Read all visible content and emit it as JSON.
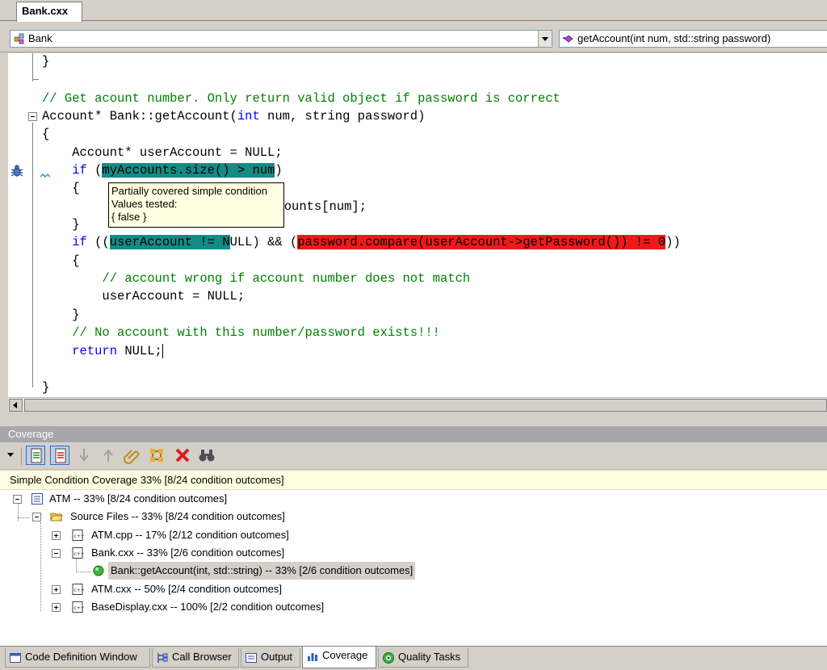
{
  "document": {
    "tab_label": "Bank.cxx"
  },
  "navigation": {
    "class_combo": "Bank",
    "member_combo": "getAccount(int num, std::string password)"
  },
  "code": {
    "l0": "}",
    "comment1": "// Get acount number. Only return valid object if password is correct",
    "sig_a": "Account* Bank::getAccount(",
    "sig_int": "int",
    "sig_b": " num, string password)",
    "l_open": "{",
    "decl": "    Account* userAccount = NULL;",
    "if_kw": "if",
    "if1_open": " (",
    "if1_cond": "myAccounts.size() > num",
    "if1_close": ")",
    "l_open2": "    {",
    "assign_tail": "nt*)myAccounts[num];",
    "l_close": "    }",
    "if2_open": " ((",
    "if2_cond1": "userAccount != N",
    "if2_mid": "ULL) && (",
    "if2_cond2": "password.compare(userAccount->getPassword()) != 0",
    "if2_close": "))",
    "l_open3": "    {",
    "comment2": "        // account wrong if account number does not match",
    "reset": "        userAccount = NULL;",
    "l_close2": "    }",
    "comment3": "    // No account with this number/password exists!!!",
    "return_kw": "return",
    "return_val": " NULL;",
    "l_end": "}"
  },
  "tooltip": {
    "title": "Partially covered simple condition",
    "line2": "Values tested:",
    "line3": " { false }"
  },
  "panel": {
    "title": "Coverage",
    "summary": "Simple Condition Coverage 33% [8/24 condition outcomes]"
  },
  "tree": {
    "atm": "ATM -- 33% [8/24 condition outcomes]",
    "source_files": "Source Files -- 33% [8/24 condition outcomes]",
    "atm_cpp": "ATM.cpp -- 17% [2/12 condition outcomes]",
    "bank_cxx": "Bank.cxx -- 33% [2/6 condition outcomes]",
    "bank_getaccount": "Bank::getAccount(int, std::string) -- 33% [2/6 condition outcomes]",
    "atm_cxx": "ATM.cxx -- 50% [2/4 condition outcomes]",
    "basedisplay_cxx": "BaseDisplay.cxx -- 100% [2/2 condition outcomes]"
  },
  "bottom_tabs": {
    "code_definition": "Code Definition Window",
    "call_browser": "Call Browser",
    "output": "Output",
    "coverage": "Coverage",
    "quality_tasks": "Quality Tasks"
  },
  "colors": {
    "covered_partial": "#148c86",
    "not_covered": "#ee1a1a",
    "comment": "#008000",
    "keyword": "#0000ff"
  }
}
